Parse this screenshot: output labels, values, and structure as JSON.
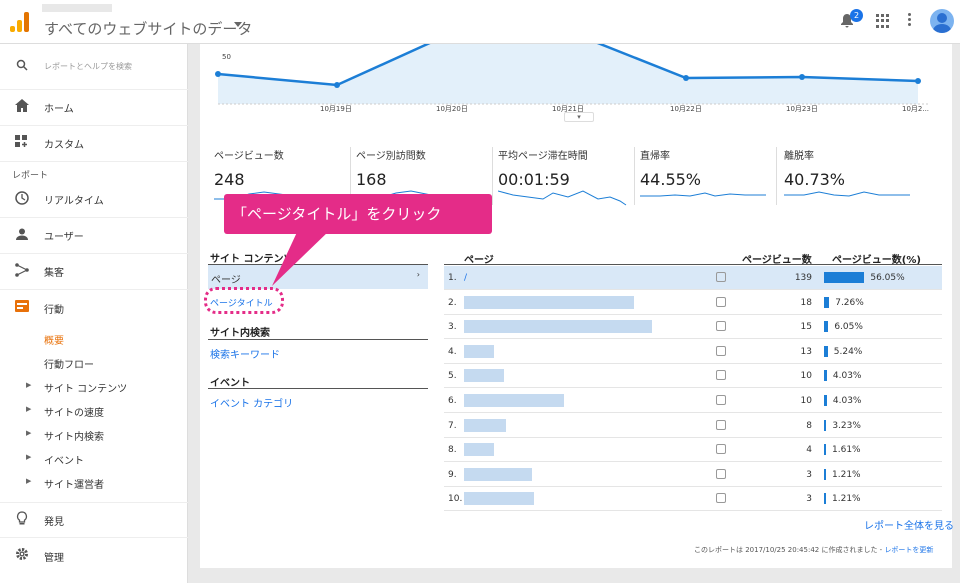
{
  "header": {
    "title": "すべてのウェブサイトのデータ",
    "notification_count": "2"
  },
  "sidebar": {
    "search_placeholder": "レポートとヘルプを検索",
    "home": "ホーム",
    "custom": "カスタム",
    "reports_label": "レポート",
    "realtime": "リアルタイム",
    "users": "ユーザー",
    "acquisition": "集客",
    "behavior": "行動",
    "behavior_sub": [
      "概要",
      "行動フロー"
    ],
    "behavior_groups": [
      "サイト コンテンツ",
      "サイトの速度",
      "サイト内検索",
      "イベント",
      "サイト運営者"
    ],
    "discover": "発見",
    "admin": "管理"
  },
  "chart_data": {
    "type": "line",
    "y_tick": "50",
    "x": [
      "10月19日",
      "10月20日",
      "10月21日",
      "10月22日",
      "10月23日",
      "10月2..."
    ]
  },
  "metrics": [
    {
      "label": "ページビュー数",
      "value": "248"
    },
    {
      "label": "ページ別訪問数",
      "value": "168"
    },
    {
      "label": "平均ページ滞在時間",
      "value": "00:01:59"
    },
    {
      "label": "直帰率",
      "value": "44.55%"
    },
    {
      "label": "離脱率",
      "value": "40.73%"
    }
  ],
  "callout": "「ページタイトル」をクリック",
  "left_panel": {
    "site_content": "サイト コンテンツ",
    "page": "ページ",
    "page_title": "ページタイトル",
    "site_search": "サイト内検索",
    "search_keyword": "検索キーワード",
    "events": "イベント",
    "event_category": "イベント カテゴリ"
  },
  "table": {
    "headers": {
      "page": "ページ",
      "pageviews": "ページビュー数",
      "pct": "ページビュー数(%)"
    },
    "rows": [
      {
        "n": "1.",
        "url": "/",
        "views": "139",
        "pct": "56.05%",
        "frac": 0.5605
      },
      {
        "n": "2.",
        "url": "",
        "views": "18",
        "pct": "7.26%",
        "frac": 0.0726
      },
      {
        "n": "3.",
        "url": "",
        "views": "15",
        "pct": "6.05%",
        "frac": 0.0605
      },
      {
        "n": "4.",
        "url": "",
        "views": "13",
        "pct": "5.24%",
        "frac": 0.0524
      },
      {
        "n": "5.",
        "url": "",
        "views": "10",
        "pct": "4.03%",
        "frac": 0.0403
      },
      {
        "n": "6.",
        "url": "",
        "views": "10",
        "pct": "4.03%",
        "frac": 0.0403
      },
      {
        "n": "7.",
        "url": "",
        "views": "8",
        "pct": "3.23%",
        "frac": 0.0323
      },
      {
        "n": "8.",
        "url": "",
        "views": "4",
        "pct": "1.61%",
        "frac": 0.0161
      },
      {
        "n": "9.",
        "url": "",
        "views": "3",
        "pct": "1.21%",
        "frac": 0.0121
      },
      {
        "n": "10.",
        "url": "",
        "views": "3",
        "pct": "1.21%",
        "frac": 0.0121
      }
    ]
  },
  "footer": {
    "view_full": "レポート全体を見る",
    "note": "このレポートは 2017/10/25 20:45:42 に作成されました - ",
    "refresh": "レポートを更新"
  }
}
